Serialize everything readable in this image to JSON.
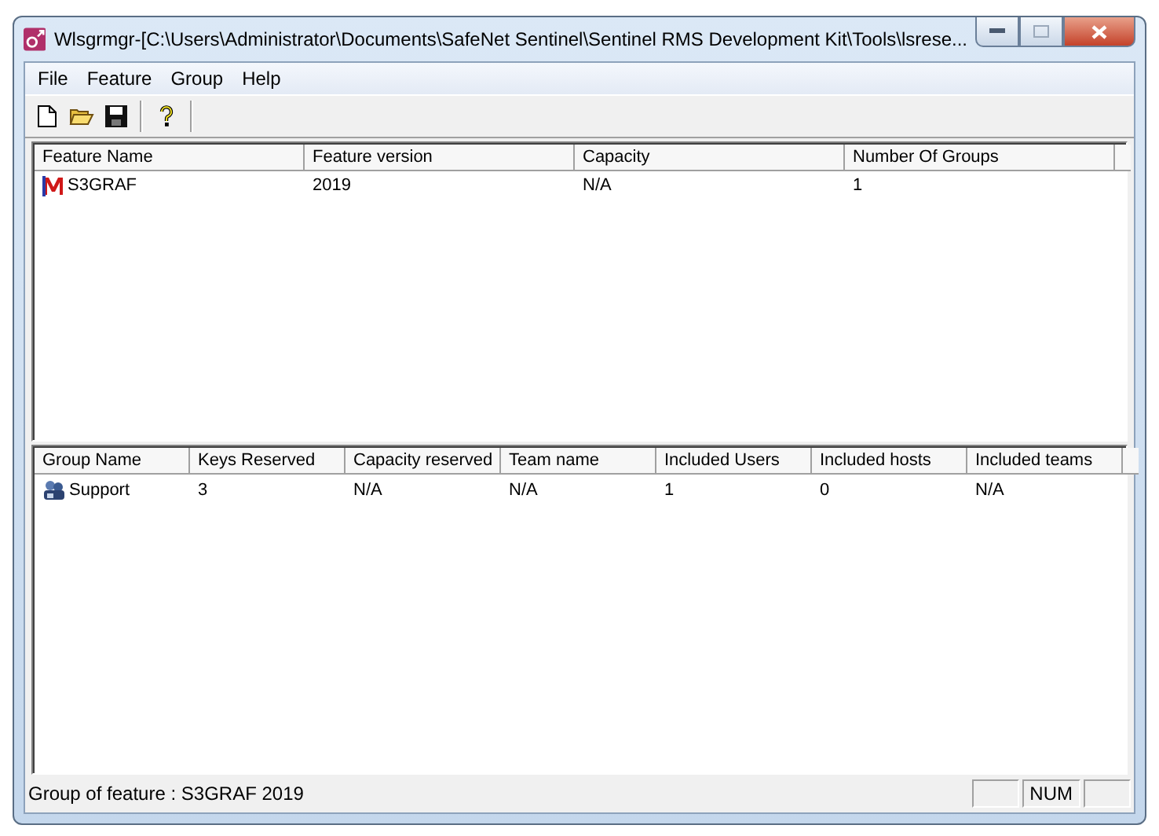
{
  "window": {
    "title": "Wlsgrmgr-[C:\\Users\\Administrator\\Documents\\SafeNet Sentinel\\Sentinel RMS Development Kit\\Tools\\lsrese..."
  },
  "menu": [
    "File",
    "Feature",
    "Group",
    "Help"
  ],
  "features": {
    "columns": [
      "Feature Name",
      "Feature version",
      "Capacity",
      "Number Of Groups"
    ],
    "rows": [
      {
        "selected": false,
        "cells": [
          "S3GRAF",
          "2019",
          "N/A",
          "1"
        ]
      }
    ]
  },
  "groups": {
    "columns": [
      "Group Name",
      "Keys Reserved",
      "Capacity reserved",
      "Team name",
      "Included Users",
      "Included hosts",
      "Included teams"
    ],
    "rows": [
      {
        "selected": false,
        "cells": [
          "Support",
          "3",
          "N/A",
          "N/A",
          "1",
          "0",
          "N/A"
        ]
      }
    ]
  },
  "status_bar": {
    "text": "Group of feature : S3GRAF 2019",
    "indicators": [
      "NUM"
    ]
  }
}
